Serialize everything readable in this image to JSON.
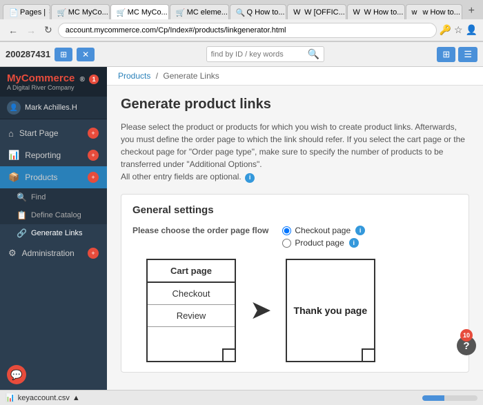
{
  "browser": {
    "tabs": [
      {
        "label": "Pages |",
        "favicon": "📄",
        "active": false
      },
      {
        "label": "MC MyCo...",
        "favicon": "🛒",
        "active": false
      },
      {
        "label": "MC MyCo...",
        "favicon": "🛒",
        "active": true
      },
      {
        "label": "MC eleme...",
        "favicon": "🛒",
        "active": false
      },
      {
        "label": "Q How to...",
        "favicon": "🔍",
        "active": false
      },
      {
        "label": "W [OFFIC...",
        "favicon": "W",
        "active": false
      },
      {
        "label": "W How to...",
        "favicon": "W",
        "active": false
      },
      {
        "label": "w How to...",
        "favicon": "w",
        "active": false
      }
    ],
    "address": "account.mycommerce.com/Cp/Index#/products/linkgenerator.html",
    "new_tab_label": "+"
  },
  "toolbar": {
    "id": "200287431",
    "btn1_label": "⊞",
    "btn2_label": "✕",
    "search_placeholder": "find by ID / key words",
    "btn3_label": "🔍",
    "btn4_label": "⊞",
    "btn5_label": "☰"
  },
  "sidebar": {
    "brand_name": "MyCommerce",
    "brand_sub": "A Digital River Company",
    "user_name": "Mark Achilles.H",
    "menu_items": [
      {
        "label": "Start Page",
        "icon": "⌂",
        "has_badge": false
      },
      {
        "label": "Reporting",
        "icon": "📊",
        "has_badge": false
      },
      {
        "label": "Products",
        "icon": "📦",
        "has_badge": false,
        "active": true
      },
      {
        "label": "Administration",
        "icon": "⚙",
        "has_badge": false
      }
    ],
    "submenu_items": [
      {
        "label": "Find",
        "icon": "🔍"
      },
      {
        "label": "Define Catalog",
        "icon": "📋"
      },
      {
        "label": "Generate Links",
        "icon": "🔗",
        "active": true
      }
    ]
  },
  "breadcrumb": {
    "items": [
      "Products",
      "Generate Links"
    ],
    "separator": "/"
  },
  "page": {
    "title": "Generate product links",
    "description_1": "Please select the product or products for which you wish to create product links. Afterwards, you must define the order page to which the link should refer. If you select the cart page or the checkout page for \"Order page type\", make sure to specify the number of products to be transferred under \"Additional Options\".",
    "description_2": "All other entry fields are optional.",
    "section_title": "General settings",
    "order_flow_label": "Please choose the order page flow",
    "radio_options": [
      {
        "label": "Checkout page",
        "checked": true
      },
      {
        "label": "Product page",
        "checked": false
      }
    ],
    "diagram": {
      "left_box": {
        "sections": [
          "Cart page",
          "Checkout",
          "Review"
        ]
      },
      "arrow": "➤",
      "right_box": {
        "label": "Thank you page"
      }
    }
  },
  "status_bar": {
    "file_name": "keyaccount.csv",
    "file_icon": "📊"
  },
  "help_button": {
    "badge_count": "10",
    "label": "?"
  }
}
